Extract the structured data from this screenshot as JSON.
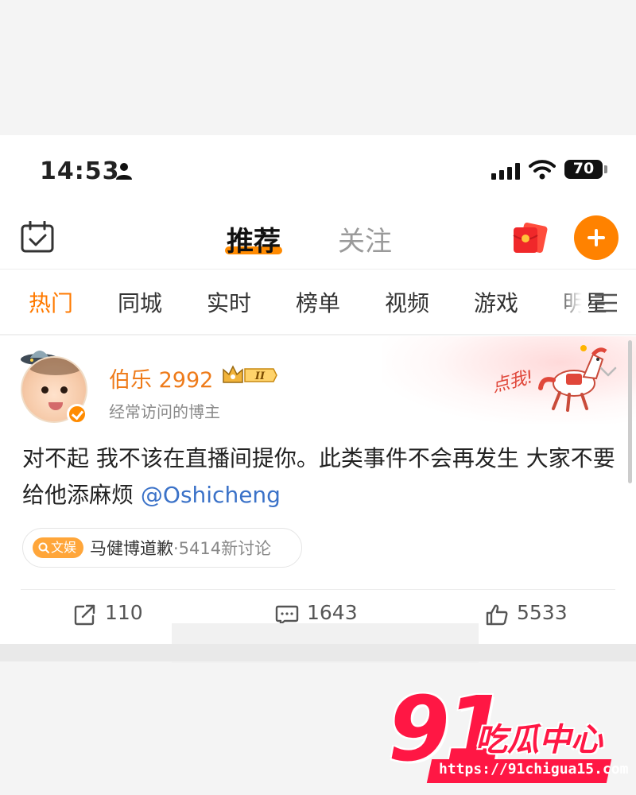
{
  "status_bar": {
    "time": "14:53",
    "battery": "70"
  },
  "header": {
    "tabs": [
      {
        "label": "推荐",
        "active": true
      },
      {
        "label": "关注",
        "active": false
      }
    ],
    "icons": [
      "calendar-icon",
      "red-packet-icon",
      "plus-icon"
    ]
  },
  "channels": [
    {
      "label": "热门",
      "active": true
    },
    {
      "label": "同城"
    },
    {
      "label": "实时"
    },
    {
      "label": "榜单"
    },
    {
      "label": "视频"
    },
    {
      "label": "游戏"
    },
    {
      "label": "明星"
    }
  ],
  "post": {
    "username": "伯乐 2992",
    "vip_level": "II",
    "subtitle": "经常访问的博主",
    "promo": "点我!",
    "text": "对不起 我不该在直播间提你。此类事件不会再发生 大家不要给他添麻烦 ",
    "mention": "@Oshicheng",
    "topic": {
      "tag": "文娱",
      "title": "马健博道歉",
      "count": "·5414新讨论"
    },
    "actions": {
      "share": "110",
      "comment": "1643",
      "like": "5533"
    }
  },
  "watermark": {
    "number": "91",
    "text": "吃瓜中心",
    "url": "https://91chigua15.com"
  },
  "colors": {
    "accent": "#ff8200",
    "username": "#ee7b1a",
    "mention": "#3b72c8",
    "watermark": "#ff1744"
  }
}
